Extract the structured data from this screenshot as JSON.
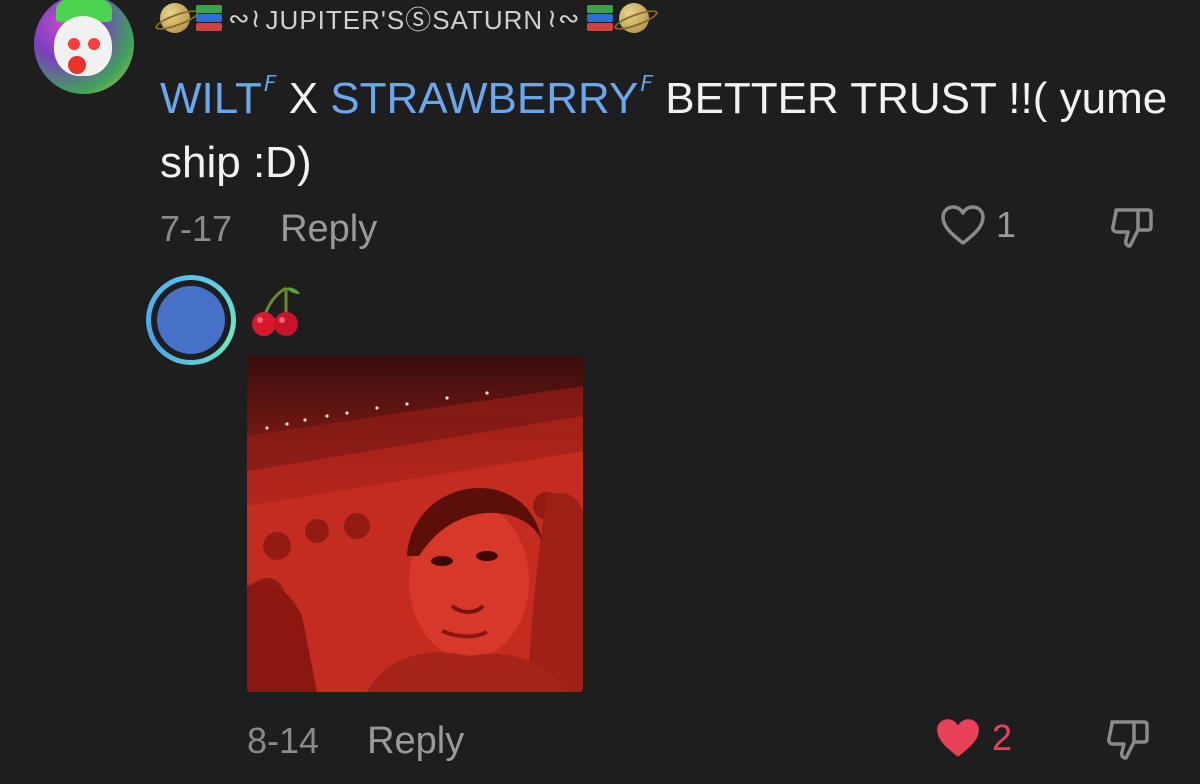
{
  "comment1": {
    "username": "JUPITER'SⓈSATURN",
    "username_prefix_decoration": "⸙∾",
    "username_suffix_decoration": "∾⸙",
    "text_mention_1": "WILT",
    "text_connector": " X ",
    "text_mention_2": "STRAWBERRY",
    "text_rest": " BETTER TRUST !!( yume ship :D)",
    "mention_icon": "ᵠ",
    "date": "7-17",
    "reply_label": "Reply",
    "like_count": "1",
    "liked": false
  },
  "comment2": {
    "text": "🍒",
    "date": "8-14",
    "reply_label": "Reply",
    "like_count": "2",
    "liked": true
  },
  "colors": {
    "background": "#1e1e1e",
    "mention": "#6aa7ee",
    "liked_heart": "#e8425a",
    "muted_text": "#8a8a8a"
  },
  "icons": {
    "like": "heart-icon",
    "dislike": "thumbs-down-icon",
    "mention": "magnifier-icon"
  }
}
